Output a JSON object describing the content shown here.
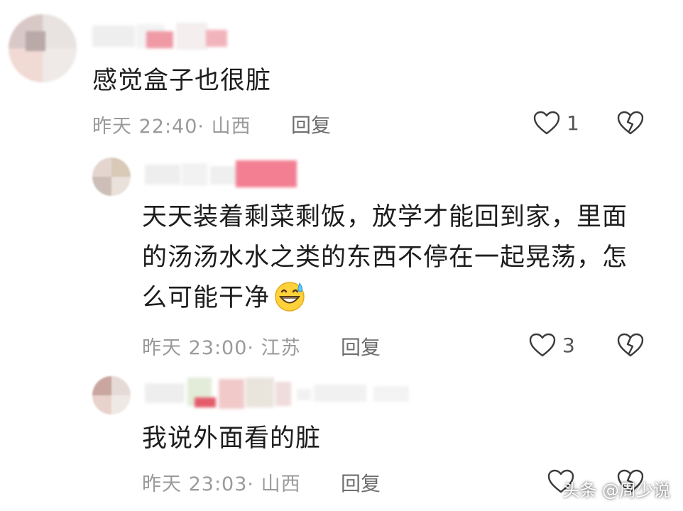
{
  "comments": [
    {
      "text": "感觉盒子也很脏",
      "time": "昨天 22:40",
      "location": "山西",
      "reply_label": "回复",
      "likes": "1"
    },
    {
      "text_lines": [
        "天天装着剩菜剩饭，放学才能回到家，里面",
        "的汤汤水水之类的东西不停在一起晃荡，怎",
        "么可能干净"
      ],
      "time": "昨天 23:00",
      "location": "江苏",
      "reply_label": "回复",
      "likes": "3"
    },
    {
      "text": "我说外面看的脏",
      "time": "昨天 23:03",
      "location": "山西",
      "reply_label": "回复"
    }
  ],
  "separator": "·",
  "watermark": "头条 @周少说",
  "icons": {
    "like": "heart-outline-icon",
    "dislike": "broken-heart-icon",
    "emoji": "grinning-sweat-emoji"
  }
}
